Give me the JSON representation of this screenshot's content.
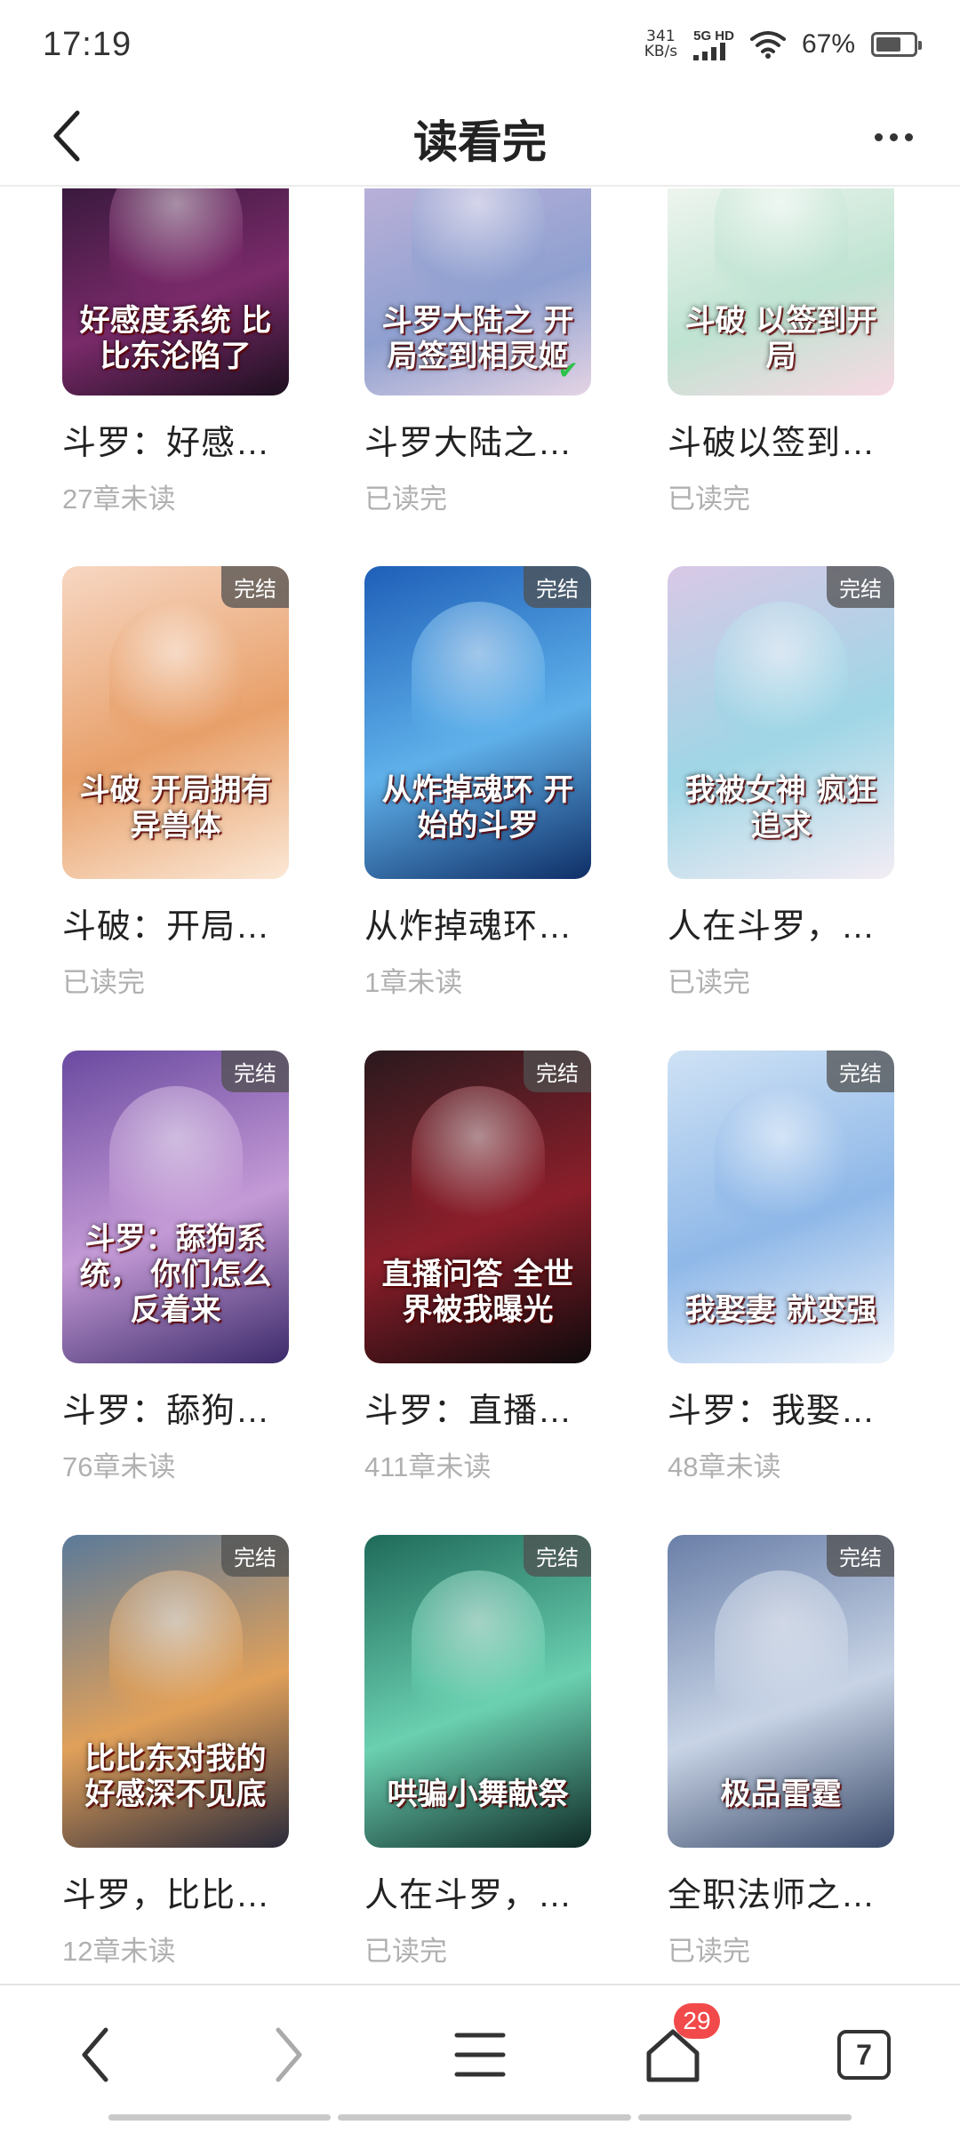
{
  "status_bar": {
    "time": "17:19",
    "net_speed_value": "341",
    "net_speed_unit": "KB/s",
    "signal_label": "5G HD",
    "battery": "67%",
    "battery_level": 0.67
  },
  "header": {
    "title": "读看完"
  },
  "books": [
    {
      "title": "斗罗：好感…",
      "status": "27章未读",
      "cover_text": "好感度系统 比比东沦陷了",
      "badge": "",
      "colors": [
        "#3a1a3e",
        "#7a2a6a",
        "#1d0f1f"
      ]
    },
    {
      "title": "斗罗大陆之…",
      "status": "已读完",
      "cover_text": "斗罗大陆之 开局签到相灵姬",
      "badge": "",
      "colors": [
        "#b9b0d8",
        "#8fa0d0",
        "#e4d4e4"
      ],
      "check": "✔"
    },
    {
      "title": "斗破以签到…",
      "status": "已读完",
      "cover_text": "斗破 以签到开局",
      "badge": "",
      "colors": [
        "#eef5ee",
        "#bfe3d2",
        "#f7d9e3"
      ]
    },
    {
      "title": "斗破：开局…",
      "status": "已读完",
      "cover_text": "斗破 开局拥有异兽体",
      "badge": "完结",
      "colors": [
        "#f7d7c3",
        "#e8a06a",
        "#fbe8d6"
      ]
    },
    {
      "title": "从炸掉魂环…",
      "status": "1章未读",
      "cover_text": "从炸掉魂环 开始的斗罗",
      "badge": "完结",
      "colors": [
        "#1e5fb8",
        "#5fb0ea",
        "#0f2e66"
      ]
    },
    {
      "title": "人在斗罗，…",
      "status": "已读完",
      "cover_text": "我被女神 疯狂追求",
      "badge": "完结",
      "colors": [
        "#d9c8e6",
        "#9fd6e6",
        "#f3ecf4"
      ]
    },
    {
      "title": "斗罗：舔狗…",
      "status": "76章未读",
      "cover_text": "斗罗：舔狗系统， 你们怎么反着来",
      "badge": "完结",
      "colors": [
        "#6a4aa0",
        "#c49ad6",
        "#3c2a6a"
      ]
    },
    {
      "title": "斗罗：直播…",
      "status": "411章未读",
      "cover_text": "直播问答 全世界被我曝光",
      "badge": "完结",
      "colors": [
        "#2a1a1e",
        "#8a1e2a",
        "#0f0a0c"
      ]
    },
    {
      "title": "斗罗：我娶…",
      "status": "48章未读",
      "cover_text": "我娶妻 就变强",
      "badge": "完结",
      "colors": [
        "#cfe2f5",
        "#8fb8e8",
        "#eef4fb"
      ]
    },
    {
      "title": "斗罗，比比…",
      "status": "12章未读",
      "cover_text": "比比东对我的好感深不见底",
      "badge": "完结",
      "colors": [
        "#5a7a9a",
        "#e0a05a",
        "#2a2a3a"
      ]
    },
    {
      "title": "人在斗罗，…",
      "status": "已读完",
      "cover_text": "哄骗小舞献祭",
      "badge": "完结",
      "colors": [
        "#1f6a5a",
        "#6ad0b0",
        "#0f2a26"
      ]
    },
    {
      "title": "全职法师之…",
      "status": "已读完",
      "cover_text": "极品雷霆",
      "badge": "完结",
      "colors": [
        "#6a7fa8",
        "#c8d4e6",
        "#3a4a6a"
      ]
    }
  ],
  "bottom_nav": {
    "home_badge": "29",
    "tab_count": "7"
  }
}
